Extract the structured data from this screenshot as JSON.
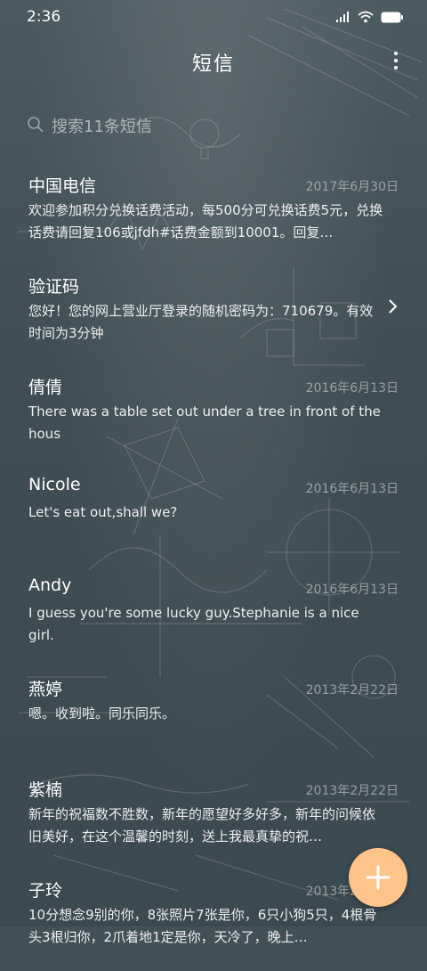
{
  "status_bar": {
    "time": "2:36",
    "icons": [
      "signal-icon",
      "wifi-icon",
      "battery-icon"
    ]
  },
  "header": {
    "title": "短信",
    "more_icon": "more-vertical-icon"
  },
  "search": {
    "placeholder": "搜索11条短信",
    "icon": "search-icon"
  },
  "conversations": [
    {
      "name": "中国电信",
      "date": "2017年6月30日",
      "preview": "欢迎参加积分兑换话费活动，每500分可兑换话费5元，兑换话费请回复106或jfdh#话费金额到10001。回复…"
    },
    {
      "name": "验证码",
      "date": "",
      "preview": "您好！您的网上营业厅登录的随机密码为：710679。有效时间为3分钟"
    },
    {
      "name": "倩倩",
      "date": "2016年6月13日",
      "preview": "There was a table set out under a tree in front of the hous"
    },
    {
      "name": "Nicole",
      "date": "2016年6月13日",
      "preview": "Let's eat out,shall we?"
    },
    {
      "name": "Andy",
      "date": "2016年6月13日",
      "preview": "I guess you're some lucky guy.Stephanie is a nice girl."
    },
    {
      "name": "燕婷",
      "date": "2013年2月22日",
      "preview": "嗯。收到啦。同乐同乐。"
    },
    {
      "name": "紫楠",
      "date": "2013年2月22日",
      "preview": "新年的祝福数不胜数，新年的愿望好多好多，新年的问候依旧美好，在这个温馨的时刻，送上我最真挚的祝…"
    },
    {
      "name": "子玲",
      "date": "2013年2月22日",
      "preview": "10分想念9别的你，8张照片7张是你，6只小狗5只，4根骨头3根归你，2爪着地1定是你，天冷了，晚上…"
    }
  ],
  "fab": {
    "icon": "plus-icon"
  },
  "colors": {
    "background": "#425158",
    "fab": "#ffc48a",
    "text": "#ffffff",
    "muted": "#9aa5aa"
  }
}
